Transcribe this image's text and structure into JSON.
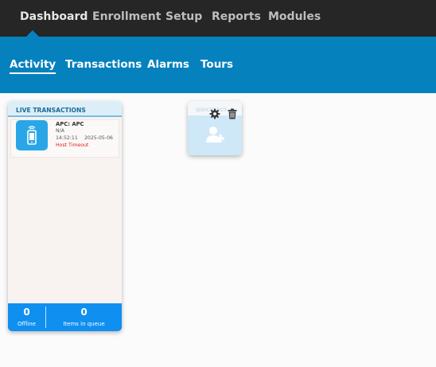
{
  "top_nav": {
    "items": [
      {
        "label": "Dashboard",
        "active": true
      },
      {
        "label": "Enrollment",
        "active": false
      },
      {
        "label": "Setup",
        "active": false
      },
      {
        "label": "Reports",
        "active": false
      },
      {
        "label": "Modules",
        "active": false
      }
    ]
  },
  "sub_nav": {
    "items": [
      {
        "label": "Activity",
        "active": true
      },
      {
        "label": "Transactions",
        "active": false
      },
      {
        "label": "Alarms",
        "active": false
      },
      {
        "label": "Tours",
        "active": false
      }
    ]
  },
  "live_transactions": {
    "title": "LIVE TRANSACTIONS",
    "items": [
      {
        "icon": "mobile-phone-icon",
        "title": "APC: APC",
        "subtitle": "N/A",
        "time": "14:52:11",
        "date": "2025-05-06",
        "status": "Host Timeout"
      }
    ],
    "footer": {
      "offline_count": "0",
      "offline_label": "Offline",
      "queue_count": "0",
      "queue_label": "Items in queue"
    }
  },
  "quick_widget": {
    "title": "QUICK ACT",
    "icons": [
      "gear-icon",
      "trash-icon",
      "add-user-icon"
    ]
  },
  "colors": {
    "top_nav_bg": "#262626",
    "sub_nav_bg": "#0581bd",
    "widget_footer_bg": "#0f8ff0",
    "status_error": "#e0201c",
    "icon_tile": "#2aa6e7"
  }
}
